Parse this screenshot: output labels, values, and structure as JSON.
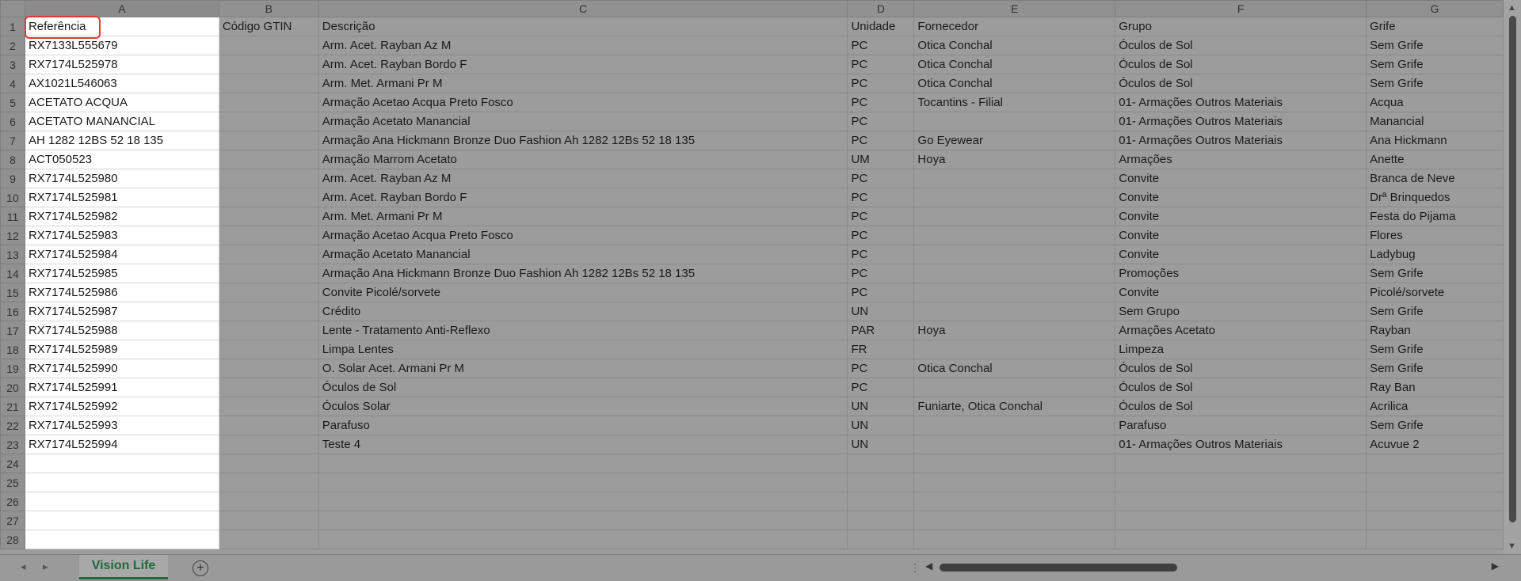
{
  "columns": [
    "A",
    "B",
    "C",
    "D",
    "E",
    "F",
    "G"
  ],
  "rows": [
    [
      "1",
      "Referência",
      "Código GTIN",
      "Descrição",
      "Unidade",
      "Fornecedor",
      "Grupo",
      "Grife"
    ],
    [
      "2",
      "RX7133L555679",
      "",
      "Arm. Acet. Rayban Az M",
      "PC",
      "Otica Conchal",
      "Óculos de Sol",
      "Sem Grife"
    ],
    [
      "3",
      "RX7174L525978",
      "",
      "Arm. Acet. Rayban Bordo F",
      "PC",
      "Otica Conchal",
      "Óculos de Sol",
      "Sem Grife"
    ],
    [
      "4",
      "AX1021L546063",
      "",
      "Arm. Met. Armani Pr M",
      "PC",
      "Otica Conchal",
      "Óculos de Sol",
      "Sem Grife"
    ],
    [
      "5",
      "ACETATO ACQUA",
      "",
      "Armação Acetao Acqua Preto Fosco",
      "PC",
      "Tocantins - Filial",
      "01- Armações Outros Materiais",
      "Acqua"
    ],
    [
      "6",
      "ACETATO MANANCIAL",
      "",
      "Armação Acetato Manancial",
      "PC",
      "",
      "01- Armações Outros Materiais",
      "Manancial"
    ],
    [
      "7",
      "AH 1282 12BS 52 18 135",
      "",
      "Armação Ana Hickmann Bronze Duo Fashion Ah 1282 12Bs 52 18 135",
      "PC",
      "Go Eyewear",
      "01- Armações Outros Materiais",
      "Ana Hickmann"
    ],
    [
      "8",
      "ACT050523",
      "",
      "Armação Marrom Acetato",
      "UM",
      "Hoya",
      "Armações",
      "Anette"
    ],
    [
      "9",
      "RX7174L525980",
      "",
      "Arm. Acet. Rayban Az M",
      "PC",
      "",
      "Convite",
      "Branca de Neve"
    ],
    [
      "10",
      "RX7174L525981",
      "",
      "Arm. Acet. Rayban Bordo F",
      "PC",
      "",
      "Convite",
      "Drª Brinquedos"
    ],
    [
      "11",
      "RX7174L525982",
      "",
      "Arm. Met. Armani Pr M",
      "PC",
      "",
      "Convite",
      "Festa do Pijama"
    ],
    [
      "12",
      "RX7174L525983",
      "",
      "Armação Acetao Acqua Preto Fosco",
      "PC",
      "",
      "Convite",
      "Flores"
    ],
    [
      "13",
      "RX7174L525984",
      "",
      "Armação Acetato Manancial",
      "PC",
      "",
      "Convite",
      "Ladybug"
    ],
    [
      "14",
      "RX7174L525985",
      "",
      "Armação Ana Hickmann Bronze Duo Fashion Ah 1282 12Bs 52 18 135",
      "PC",
      "",
      "Promoções",
      "Sem Grife"
    ],
    [
      "15",
      "RX7174L525986",
      "",
      "Convite Picolé/sorvete",
      "PC",
      "",
      "Convite",
      "Picolé/sorvete"
    ],
    [
      "16",
      "RX7174L525987",
      "",
      "Crédito",
      "UN",
      "",
      "Sem Grupo",
      "Sem Grife"
    ],
    [
      "17",
      "RX7174L525988",
      "",
      "Lente - Tratamento Anti-Reflexo",
      "PAR",
      "Hoya",
      "Armações Acetato",
      "Rayban"
    ],
    [
      "18",
      "RX7174L525989",
      "",
      "Limpa Lentes",
      "FR",
      "",
      "Limpeza",
      "Sem Grife"
    ],
    [
      "19",
      "RX7174L525990",
      "",
      "O. Solar Acet. Armani Pr M",
      "PC",
      "Otica Conchal",
      "Óculos de Sol",
      "Sem Grife"
    ],
    [
      "20",
      "RX7174L525991",
      "",
      "Óculos de Sol",
      "PC",
      "",
      "Óculos de Sol",
      "Ray Ban"
    ],
    [
      "21",
      "RX7174L525992",
      "",
      "Óculos Solar",
      "UN",
      "Funiarte, Otica Conchal",
      "Óculos de Sol",
      "Acrilica"
    ],
    [
      "22",
      "RX7174L525993",
      "",
      "Parafuso",
      "UN",
      "",
      "Parafuso",
      "Sem Grife"
    ],
    [
      "23",
      "RX7174L525994",
      "",
      "Teste 4",
      "UN",
      "",
      "01- Armações Outros Materiais",
      "Acuvue 2"
    ],
    [
      "24",
      "",
      "",
      "",
      "",
      "",
      "",
      ""
    ],
    [
      "25",
      "",
      "",
      "",
      "",
      "",
      "",
      ""
    ],
    [
      "26",
      "",
      "",
      "",
      "",
      "",
      "",
      ""
    ],
    [
      "27",
      "",
      "",
      "",
      "",
      "",
      "",
      ""
    ],
    [
      "28",
      "",
      "",
      "",
      "",
      "",
      "",
      ""
    ]
  ],
  "tabs": {
    "active_sheet": "Vision Life",
    "add_sheet_icon": "+"
  },
  "colors": {
    "sheet_tab_accent": "#1e6a3a",
    "highlight_box": "#e53935"
  }
}
